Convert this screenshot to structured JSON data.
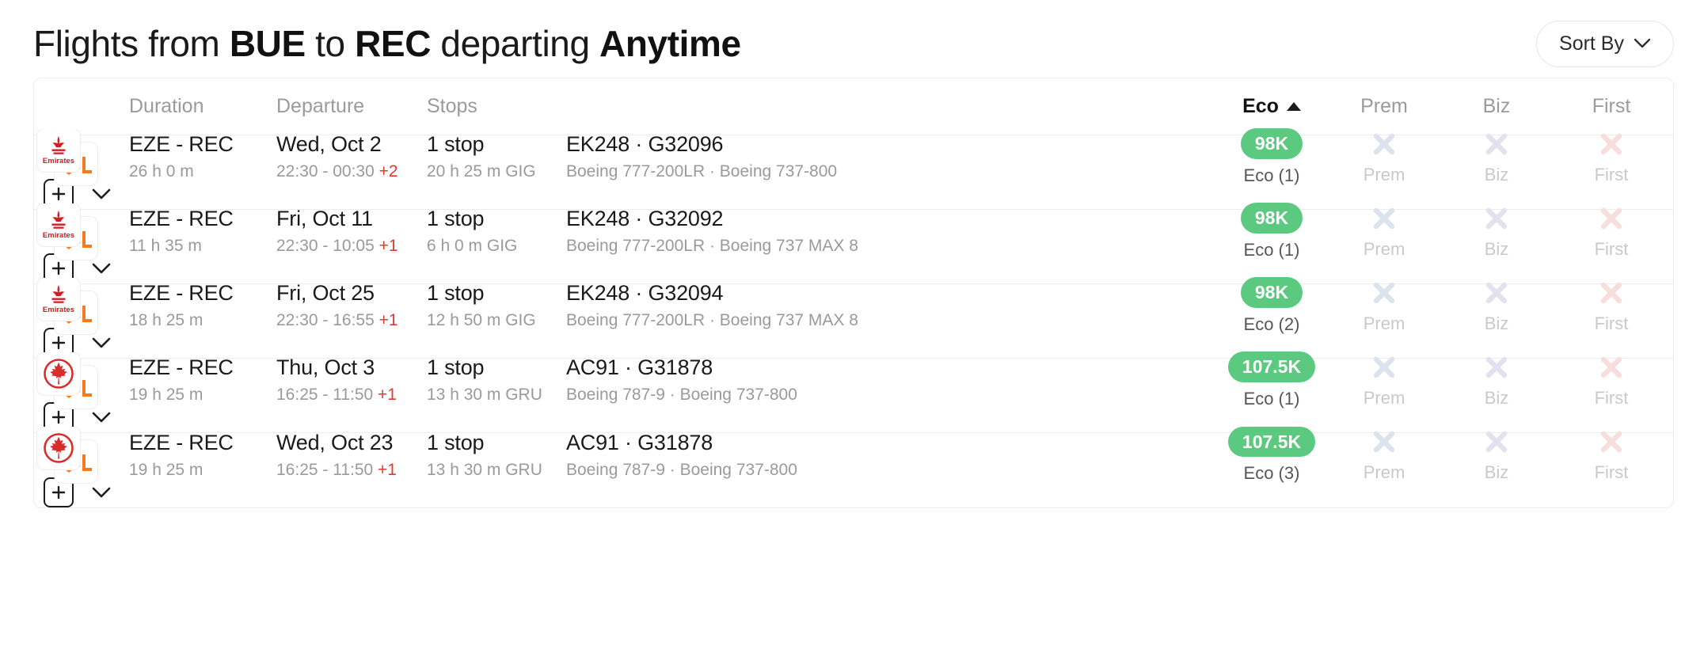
{
  "header": {
    "title_prefix": "Flights from ",
    "origin": "BUE",
    "title_mid": " to ",
    "destination": "REC",
    "title_suffix": " departing ",
    "when": "Anytime",
    "sort_button_label": "Sort By",
    "sort_chevron_icon": "chevron-down-icon"
  },
  "table": {
    "columns": {
      "logo": "",
      "duration": "Duration",
      "departure": "Departure",
      "stops": "Stops",
      "flights": "",
      "eco": "Eco",
      "eco_sort_icon": "caret-up-icon",
      "prem": "Prem",
      "biz": "Biz",
      "first": "First"
    },
    "accent_price_color": "#5bc97f",
    "plus_day_color": "#e03b33",
    "rows": [
      {
        "airline_logo": "emirates-logo",
        "airline_logo_secondary": "gol-logo",
        "route": "EZE - REC",
        "duration": "26 h 0 m",
        "departure_date": "Wed, Oct 2",
        "departure_times": "22:30 - 00:30 ",
        "departure_plus": "+2",
        "stops": "1 stop",
        "layover": "20 h 25 m  GIG",
        "flight_numbers": "EK248  ·  G32096",
        "aircraft": "Boeing 777-200LR  ·  Boeing 737-800",
        "eco_price": "98K",
        "eco_label": "Eco (1)",
        "prem_label": "Prem",
        "biz_label": "Biz",
        "first_label": "First",
        "add_icon": "plus-square-icon",
        "expand_icon": "chevron-down-icon"
      },
      {
        "airline_logo": "emirates-logo",
        "airline_logo_secondary": "gol-logo",
        "route": "EZE - REC",
        "duration": "11 h 35 m",
        "departure_date": "Fri, Oct 11",
        "departure_times": "22:30 - 10:05 ",
        "departure_plus": "+1",
        "stops": "1 stop",
        "layover": "6 h 0 m  GIG",
        "flight_numbers": "EK248  ·  G32092",
        "aircraft": "Boeing 777-200LR  ·  Boeing 737 MAX 8",
        "eco_price": "98K",
        "eco_label": "Eco (1)",
        "prem_label": "Prem",
        "biz_label": "Biz",
        "first_label": "First",
        "add_icon": "plus-square-icon",
        "expand_icon": "chevron-down-icon"
      },
      {
        "airline_logo": "emirates-logo",
        "airline_logo_secondary": "gol-logo",
        "route": "EZE - REC",
        "duration": "18 h 25 m",
        "departure_date": "Fri, Oct 25",
        "departure_times": "22:30 - 16:55 ",
        "departure_plus": "+1",
        "stops": "1 stop",
        "layover": "12 h 50 m  GIG",
        "flight_numbers": "EK248  ·  G32094",
        "aircraft": "Boeing 777-200LR  ·  Boeing 737 MAX 8",
        "eco_price": "98K",
        "eco_label": "Eco (2)",
        "prem_label": "Prem",
        "biz_label": "Biz",
        "first_label": "First",
        "add_icon": "plus-square-icon",
        "expand_icon": "chevron-down-icon"
      },
      {
        "airline_logo": "air-canada-logo",
        "airline_logo_secondary": "gol-logo",
        "route": "EZE - REC",
        "duration": "19 h 25 m",
        "departure_date": "Thu, Oct 3",
        "departure_times": "16:25 - 11:50 ",
        "departure_plus": "+1",
        "stops": "1 stop",
        "layover": "13 h 30 m  GRU",
        "flight_numbers": "AC91  ·  G31878",
        "aircraft": "Boeing 787-9  ·  Boeing 737-800",
        "eco_price": "107.5K",
        "eco_label": "Eco (1)",
        "prem_label": "Prem",
        "biz_label": "Biz",
        "first_label": "First",
        "add_icon": "plus-square-icon",
        "expand_icon": "chevron-down-icon"
      },
      {
        "airline_logo": "air-canada-logo",
        "airline_logo_secondary": "gol-logo",
        "route": "EZE - REC",
        "duration": "19 h 25 m",
        "departure_date": "Wed, Oct 23",
        "departure_times": "16:25 - 11:50 ",
        "departure_plus": "+1",
        "stops": "1 stop",
        "layover": "13 h 30 m  GRU",
        "flight_numbers": "AC91  ·  G31878",
        "aircraft": "Boeing 787-9  ·  Boeing 737-800",
        "eco_price": "107.5K",
        "eco_label": "Eco (3)",
        "prem_label": "Prem",
        "biz_label": "Biz",
        "first_label": "First",
        "add_icon": "plus-square-icon",
        "expand_icon": "chevron-down-icon"
      }
    ]
  }
}
